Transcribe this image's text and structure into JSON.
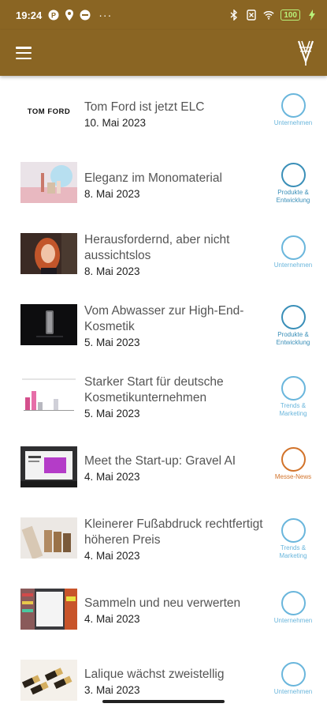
{
  "status_bar": {
    "time": "19:24",
    "battery": "100",
    "icons": [
      "notification-p-icon",
      "location-icon",
      "vpn-icon",
      "more-dots",
      "bluetooth-icon",
      "sim-off-icon",
      "wifi-icon",
      "battery-icon",
      "charging-icon"
    ],
    "dots": "···"
  },
  "app_bar": {
    "menu_icon": "hamburger-menu-icon",
    "logo_icon": "brand-logo-icon",
    "color": "#8a6523"
  },
  "colors": {
    "unternehmen": "#6ab6dc",
    "produkte": "#3a8fb8",
    "trends": "#6ab6dc",
    "messe": "#d2732a"
  },
  "articles": [
    {
      "title": "Tom Ford ist jetzt ELC",
      "date": "10. Mai 2023",
      "category": "Unternehmen",
      "thumb_text": "TOM FORD"
    },
    {
      "title": "Eleganz im Monomaterial",
      "date": "8. Mai 2023",
      "category": "Produkte & Entwicklung"
    },
    {
      "title": "Herausfordernd, aber nicht aussichtslos",
      "date": "8. Mai 2023",
      "category": "Unternehmen"
    },
    {
      "title": "Vom Abwasser zur High-End-Kosmetik",
      "date": "5. Mai 2023",
      "category": "Produkte & Entwicklung"
    },
    {
      "title": "Starker Start für deutsche Kosmetikunternehmen",
      "date": "5. Mai 2023",
      "category": "Trends & Marketing"
    },
    {
      "title": "Meet the Start-up: Gravel AI",
      "date": "4. Mai 2023",
      "category": "Messe-News"
    },
    {
      "title": "Kleinerer Fußabdruck rechtfertigt höheren Preis",
      "date": "4. Mai 2023",
      "category": "Trends & Marketing"
    },
    {
      "title": "Sammeln und neu verwerten",
      "date": "4. Mai 2023",
      "category": "Unternehmen"
    },
    {
      "title": "Lalique wächst zweistellig",
      "date": "3. Mai 2023",
      "category": "Unternehmen"
    }
  ]
}
